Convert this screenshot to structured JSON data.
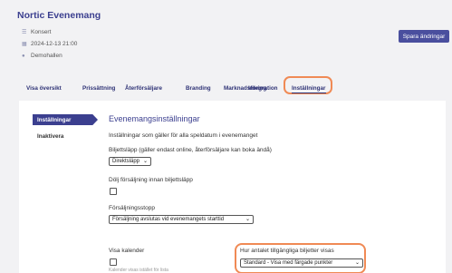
{
  "event": {
    "title": "Nortic Evenemang",
    "type": "Konsert",
    "datetime": "2024-12-13 21:00",
    "venue": "Demohallen"
  },
  "actions": {
    "save_label": "Spara ändringar"
  },
  "tabs": [
    {
      "label": "Visa översikt"
    },
    {
      "label": "Prissättning"
    },
    {
      "label": "Återförsäljare"
    },
    {
      "label": "Branding"
    },
    {
      "label": "Marknadsföring"
    },
    {
      "label": "Integration"
    },
    {
      "label": "Inställningar",
      "active": true
    }
  ],
  "sidebar": {
    "items": [
      {
        "label": "Inställningar",
        "active": true
      },
      {
        "label": "Inaktivera"
      }
    ]
  },
  "settings": {
    "title": "Evenemangsinställningar",
    "intro": "Inställningar som gäller för alla speldatum i evenemanget",
    "release_label": "Biljettsläpp (gäller endast online, återförsäljare kan boka ändå)",
    "release_value": "Direktsläpp",
    "hide_label": "Dölj försäljning innan biljettsläpp",
    "stop_label": "Försäljningsstopp",
    "stop_value": "Försäljning avslutas vid evenemangets starttid",
    "calendar_label": "Visa kalender",
    "calendar_hint": "Kalender visas istället för lista",
    "availability_label": "Hur antalet tillgängliga biljetter visas",
    "availability_value": "Standard - Visa med färgade punkter"
  },
  "icons": {
    "type": "list-icon",
    "datetime": "calendar-icon",
    "venue": "location-pin-icon",
    "chevron": "chevron-down-icon"
  },
  "colors": {
    "brand": "#3b3f8f",
    "button": "#4a4f9e",
    "highlight": "#f08a55"
  }
}
